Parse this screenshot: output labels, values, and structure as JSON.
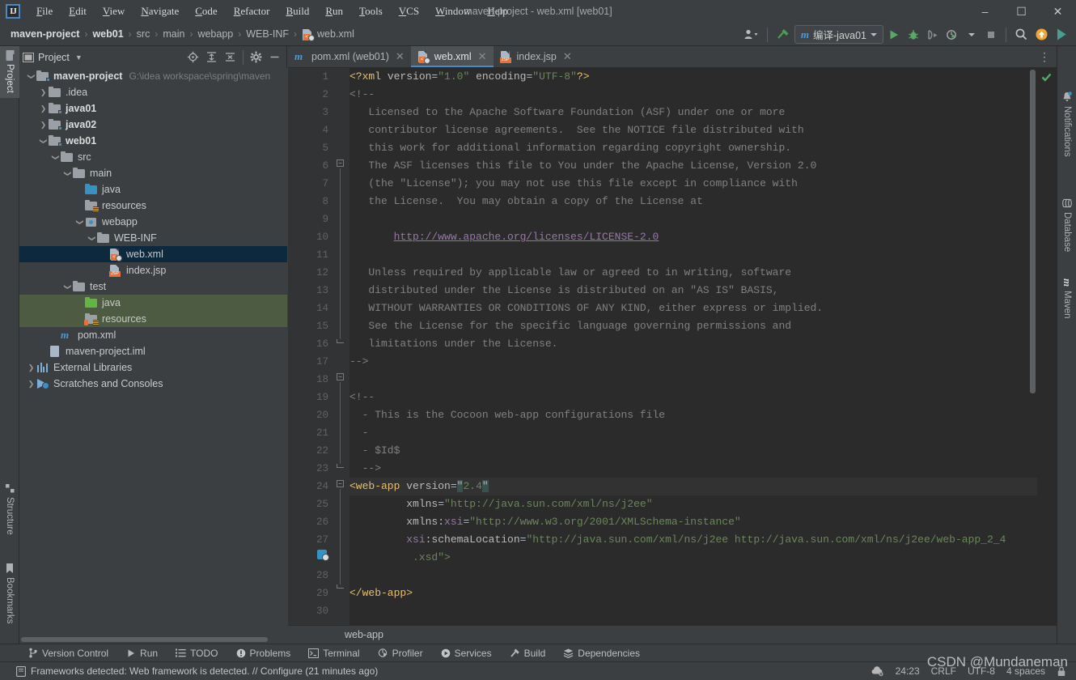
{
  "window": {
    "title": "maven-project - web.xml [web01]",
    "minimize_label": "–",
    "maximize_label": "☐",
    "close_label": "✕"
  },
  "menu": {
    "items": [
      "File",
      "Edit",
      "View",
      "Navigate",
      "Code",
      "Refactor",
      "Build",
      "Run",
      "Tools",
      "VCS",
      "Window",
      "Help"
    ]
  },
  "breadcrumb": {
    "items": [
      "maven-project",
      "web01",
      "src",
      "main",
      "webapp",
      "WEB-INF",
      "web.xml"
    ],
    "separator": "›"
  },
  "toolbar": {
    "run_config_icon": "maven-m-icon",
    "run_config_prefix": "m",
    "run_config_label": "编译-java01",
    "buttons": [
      {
        "name": "user-account-icon",
        "label": ""
      },
      {
        "name": "build-hammer-icon",
        "label": ""
      },
      {
        "name": "run-icon",
        "label": ""
      },
      {
        "name": "debug-icon",
        "label": ""
      },
      {
        "name": "run-with-coverage-icon",
        "label": ""
      },
      {
        "name": "profiler-icon",
        "label": ""
      },
      {
        "name": "stop-icon",
        "label": ""
      },
      {
        "name": "search-everywhere-icon",
        "label": ""
      },
      {
        "name": "update-project-icon",
        "label": ""
      },
      {
        "name": "ide-feature-icon",
        "label": ""
      }
    ]
  },
  "left_strip": {
    "top": [
      {
        "label": "Project",
        "icon": "project-folder-icon",
        "active": true
      }
    ],
    "bottom": [
      {
        "label": "Structure",
        "icon": "structure-icon"
      },
      {
        "label": "Bookmarks",
        "icon": "bookmark-icon"
      }
    ]
  },
  "right_strip": {
    "items": [
      {
        "label": "Notifications",
        "icon": "bell-icon"
      },
      {
        "label": "Database",
        "icon": "database-icon"
      },
      {
        "label": "Maven",
        "icon": "maven-m-icon"
      }
    ]
  },
  "project_panel": {
    "title": "Project",
    "dropdown_caret": "▼",
    "icons": [
      {
        "name": "select-opened-file-icon"
      },
      {
        "name": "expand-all-icon"
      },
      {
        "name": "collapse-all-icon"
      },
      {
        "name": "settings-gear-icon"
      },
      {
        "name": "hide-panel-icon"
      }
    ],
    "tree": [
      {
        "label": "maven-project",
        "path": "G:\\idea workspace\\spring\\maven",
        "indent": 0,
        "arrow": "down",
        "icon": "module-folder",
        "bold": true
      },
      {
        "label": ".idea",
        "indent": 1,
        "arrow": "right",
        "icon": "folder-grey"
      },
      {
        "label": "java01",
        "indent": 1,
        "arrow": "right",
        "icon": "module-folder",
        "bold": true
      },
      {
        "label": "java02",
        "indent": 1,
        "arrow": "right",
        "icon": "module-folder",
        "bold": true
      },
      {
        "label": "web01",
        "indent": 1,
        "arrow": "down",
        "icon": "module-folder",
        "bold": true
      },
      {
        "label": "src",
        "indent": 2,
        "arrow": "down",
        "icon": "folder-grey"
      },
      {
        "label": "main",
        "indent": 3,
        "arrow": "down",
        "icon": "folder-grey"
      },
      {
        "label": "java",
        "indent": 4,
        "arrow": "none",
        "icon": "folder-blue"
      },
      {
        "label": "resources",
        "indent": 4,
        "arrow": "none",
        "icon": "folder-resources"
      },
      {
        "label": "webapp",
        "indent": 4,
        "arrow": "down",
        "icon": "folder-webapp"
      },
      {
        "label": "WEB-INF",
        "indent": 5,
        "arrow": "down",
        "icon": "folder-grey"
      },
      {
        "label": "web.xml",
        "indent": 6,
        "arrow": "none",
        "icon": "file-xml",
        "selected": true
      },
      {
        "label": "index.jsp",
        "indent": 6,
        "arrow": "none",
        "icon": "file-jsp"
      },
      {
        "label": "test",
        "indent": 3,
        "arrow": "down",
        "icon": "folder-grey"
      },
      {
        "label": "java",
        "indent": 4,
        "arrow": "none",
        "icon": "folder-green",
        "testroot": true
      },
      {
        "label": "resources",
        "indent": 4,
        "arrow": "none",
        "icon": "folder-test-resources",
        "testroot": true
      },
      {
        "label": "pom.xml",
        "indent": 2,
        "arrow": "none",
        "icon": "file-maven"
      },
      {
        "label": "maven-project.iml",
        "indent": 1,
        "arrow": "none",
        "icon": "file-iml"
      },
      {
        "label": "External Libraries",
        "indent": 0,
        "arrow": "right",
        "icon": "external-libraries"
      },
      {
        "label": "Scratches and Consoles",
        "indent": 0,
        "arrow": "right",
        "icon": "scratches"
      }
    ]
  },
  "editor": {
    "tabs": [
      {
        "label": "pom.xml (web01)",
        "icon": "maven-m-icon",
        "active": false,
        "close": "✕"
      },
      {
        "label": "web.xml",
        "icon": "xml-file-icon",
        "active": true,
        "close": "✕"
      },
      {
        "label": "index.jsp",
        "icon": "jsp-file-icon",
        "active": false,
        "close": "✕"
      }
    ],
    "more_tabs_icon": "⋮",
    "inspection_status": "no-errors-checkmark",
    "breadcrumb_bottom": "web-app",
    "line_count": 30,
    "current_line": 24,
    "lines": [
      {
        "n": 1,
        "tokens": [
          {
            "t": "<?xml ",
            "c": "tag"
          },
          {
            "t": "version",
            "c": "attr"
          },
          {
            "t": "=",
            "c": "punc"
          },
          {
            "t": "\"1.0\"",
            "c": "attrv"
          },
          {
            "t": " ",
            "c": "punc"
          },
          {
            "t": "encoding",
            "c": "attr"
          },
          {
            "t": "=",
            "c": "punc"
          },
          {
            "t": "\"UTF-8\"",
            "c": "attrv"
          },
          {
            "t": "?>",
            "c": "tag"
          }
        ]
      },
      {
        "n": 2,
        "tokens": [
          {
            "t": "<!--",
            "c": "cmt"
          }
        ]
      },
      {
        "n": 3,
        "tokens": [
          {
            "t": "   Licensed to the Apache Software Foundation (ASF) under one or more",
            "c": "cmt"
          }
        ]
      },
      {
        "n": 4,
        "tokens": [
          {
            "t": "   contributor license agreements.  See the NOTICE file distributed with",
            "c": "cmt"
          }
        ]
      },
      {
        "n": 5,
        "tokens": [
          {
            "t": "   this work for additional information regarding copyright ownership.",
            "c": "cmt"
          }
        ]
      },
      {
        "n": 6,
        "tokens": [
          {
            "t": "   The ASF licenses this file to You under the Apache License, Version 2.0",
            "c": "cmt"
          }
        ]
      },
      {
        "n": 7,
        "tokens": [
          {
            "t": "   (the \"License\"); you may not use this file except in compliance with",
            "c": "cmt"
          }
        ]
      },
      {
        "n": 8,
        "tokens": [
          {
            "t": "   the License.  You may obtain a copy of the License at",
            "c": "cmt"
          }
        ]
      },
      {
        "n": 9,
        "tokens": []
      },
      {
        "n": 10,
        "tokens": [
          {
            "t": "       ",
            "c": "cmt"
          },
          {
            "t": "http://www.apache.org/licenses/LICENSE-2.0",
            "c": "lnk"
          }
        ]
      },
      {
        "n": 11,
        "tokens": []
      },
      {
        "n": 12,
        "tokens": [
          {
            "t": "   Unless required by applicable law or agreed to in writing, software",
            "c": "cmt"
          }
        ]
      },
      {
        "n": 13,
        "tokens": [
          {
            "t": "   distributed under the License is distributed on an \"AS IS\" BASIS,",
            "c": "cmt"
          }
        ]
      },
      {
        "n": 14,
        "tokens": [
          {
            "t": "   WITHOUT WARRANTIES OR CONDITIONS OF ANY KIND, either express or implied.",
            "c": "cmt"
          }
        ]
      },
      {
        "n": 15,
        "tokens": [
          {
            "t": "   See the License for the specific language governing permissions and",
            "c": "cmt"
          }
        ]
      },
      {
        "n": 16,
        "tokens": [
          {
            "t": "   limitations under the License.",
            "c": "cmt"
          }
        ]
      },
      {
        "n": 17,
        "tokens": [
          {
            "t": "-->",
            "c": "cmt"
          }
        ]
      },
      {
        "n": 18,
        "tokens": []
      },
      {
        "n": 19,
        "tokens": [
          {
            "t": "<!--",
            "c": "cmt"
          }
        ]
      },
      {
        "n": 20,
        "tokens": [
          {
            "t": "  - This is the Cocoon web-app configurations file",
            "c": "cmt"
          }
        ]
      },
      {
        "n": 21,
        "tokens": [
          {
            "t": "  -",
            "c": "cmt"
          }
        ]
      },
      {
        "n": 22,
        "tokens": [
          {
            "t": "  - $Id$",
            "c": "cmt"
          }
        ]
      },
      {
        "n": 23,
        "tokens": [
          {
            "t": "  -->",
            "c": "cmt"
          }
        ]
      },
      {
        "n": 24,
        "tokens": [
          {
            "t": "<web-app",
            "c": "tag"
          },
          {
            "t": " ",
            "c": "punc"
          },
          {
            "t": "version",
            "c": "attr"
          },
          {
            "t": "=",
            "c": "punc"
          },
          {
            "t": "\"",
            "c": "matchhl"
          },
          {
            "t": "2.4",
            "c": "attrv"
          },
          {
            "t": "\"",
            "c": "matchhl"
          }
        ]
      },
      {
        "n": 25,
        "tokens": [
          {
            "t": "         ",
            "c": "punc"
          },
          {
            "t": "xmlns",
            "c": "attr"
          },
          {
            "t": "=",
            "c": "punc"
          },
          {
            "t": "\"http://java.sun.com/xml/ns/j2ee\"",
            "c": "attrv"
          }
        ]
      },
      {
        "n": 26,
        "tokens": [
          {
            "t": "         ",
            "c": "punc"
          },
          {
            "t": "xmlns:",
            "c": "attr"
          },
          {
            "t": "xsi",
            "c": "ns"
          },
          {
            "t": "=",
            "c": "punc"
          },
          {
            "t": "\"http://www.w3.org/2001/XMLSchema-instance\"",
            "c": "attrv"
          }
        ]
      },
      {
        "n": 27,
        "tokens": [
          {
            "t": "         ",
            "c": "punc"
          },
          {
            "t": "xsi",
            "c": "ns"
          },
          {
            "t": ":schemaLocation",
            "c": "attr"
          },
          {
            "t": "=",
            "c": "punc"
          },
          {
            "t": "\"http://java.sun.com/xml/ns/j2ee http://java.sun.com/xml/ns/j2ee/web-app_2_4",
            "c": "attrv"
          }
        ]
      },
      {
        "n": null,
        "tokens": [
          {
            "t": "          .xsd\">",
            "c": "attrv"
          }
        ]
      },
      {
        "n": 28,
        "tokens": []
      },
      {
        "n": 29,
        "tokens": [
          {
            "t": "</web-app>",
            "c": "tag"
          }
        ]
      },
      {
        "n": 30,
        "tokens": []
      }
    ]
  },
  "toolwindow_bar": {
    "items": [
      {
        "label": "Version Control",
        "icon": "branch-icon"
      },
      {
        "label": "Run",
        "icon": "run-triangle-icon"
      },
      {
        "label": "TODO",
        "icon": "todo-list-icon"
      },
      {
        "label": "Problems",
        "icon": "problems-icon"
      },
      {
        "label": "Terminal",
        "icon": "terminal-icon"
      },
      {
        "label": "Profiler",
        "icon": "profiler-icon"
      },
      {
        "label": "Services",
        "icon": "services-icon"
      },
      {
        "label": "Build",
        "icon": "build-hammer-icon"
      },
      {
        "label": "Dependencies",
        "icon": "dependencies-icon"
      }
    ]
  },
  "statusbar": {
    "message_icon": "notification-icon",
    "message": "Frameworks detected: Web framework is detected. // Configure (21 minutes ago)",
    "right": [
      {
        "name": "background-tasks-icon",
        "label": ""
      },
      {
        "name": "caret-position",
        "label": "24:23"
      },
      {
        "name": "line-separator",
        "label": "CRLF"
      },
      {
        "name": "file-encoding",
        "label": "UTF-8"
      },
      {
        "name": "indent-setting",
        "label": "4 spaces"
      },
      {
        "name": "lock-icon",
        "label": ""
      }
    ]
  },
  "watermark": {
    "text": "CSDN @Mundaneman"
  },
  "colors": {
    "bg_chrome": "#3c3f41",
    "bg_editor": "#2b2b2b",
    "gutter": "#313335",
    "accent_blue": "#4a88c7",
    "tag_orange": "#e8bf6a",
    "string_green": "#6a8759",
    "comment_grey": "#808080",
    "link_purple": "#9876aa",
    "selection_navy": "#0d293e",
    "testroot_green": "#4d5b43"
  }
}
